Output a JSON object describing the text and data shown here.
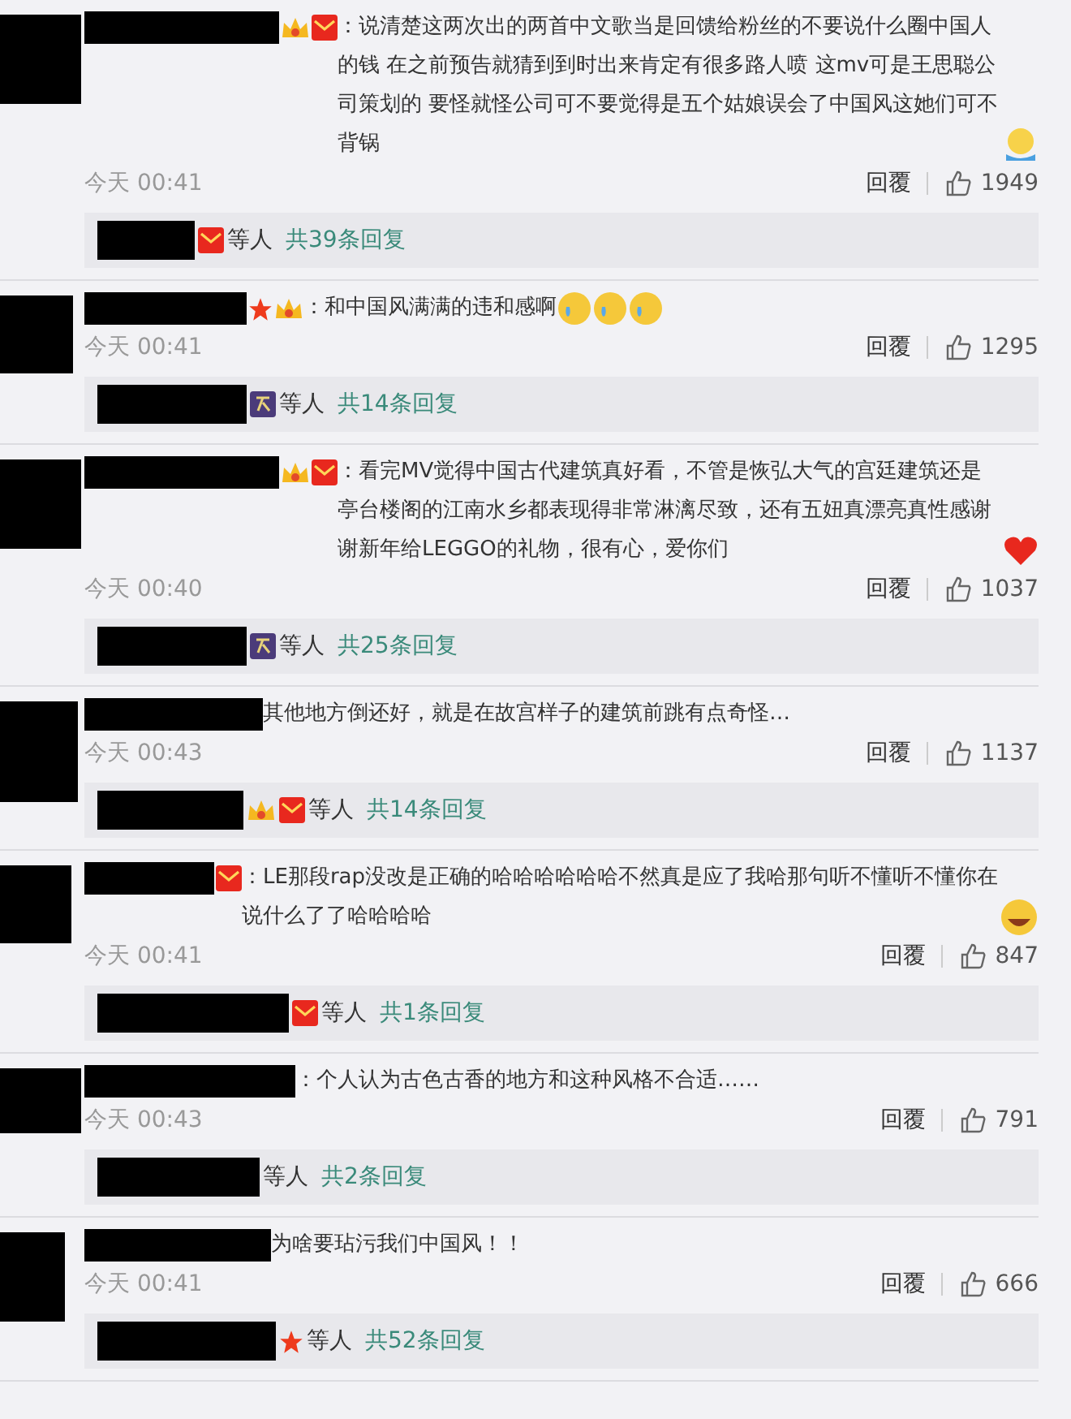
{
  "comments": [
    {
      "badges": [
        {
          "kind": "crown"
        },
        {
          "kind": "envelope"
        }
      ],
      "text": "：说清楚这两次出的两首中文歌当是回馈给粉丝的不要说什么圈中国人的钱 在之前预告就猜到到时出来肯定有很多路人喷 这mv可是王思聪公司策划的 要怪就怪公司可不要觉得是五个姑娘误会了中国风这她们可不背锅",
      "emoji": [
        {
          "kind": "shrug"
        }
      ],
      "time": "今天 00:41",
      "reply_label": "回覆",
      "likes": "1949",
      "replies": {
        "badges": [
          {
            "kind": "envelope"
          }
        ],
        "suffix": "等人",
        "link": "共39条回复"
      }
    },
    {
      "badges": [
        {
          "kind": "star"
        },
        {
          "kind": "crown"
        }
      ],
      "text": "：和中国风满满的违和感啊",
      "emoji": [
        {
          "kind": "cry"
        },
        {
          "kind": "cry"
        },
        {
          "kind": "cry"
        }
      ],
      "time": "今天 00:41",
      "reply_label": "回覆",
      "likes": "1295",
      "replies": {
        "badges": [
          {
            "kind": "night"
          }
        ],
        "suffix": "等人",
        "link": "共14条回复"
      }
    },
    {
      "badges": [
        {
          "kind": "crown"
        },
        {
          "kind": "envelope"
        }
      ],
      "text": "：看完MV觉得中国古代建筑真好看，不管是恢弘大气的宫廷建筑还是亭台楼阁的江南水乡都表现得非常淋漓尽致，还有五妞真漂亮真性感谢谢新年给LEGGO的礼物，很有心，爱你们",
      "emoji": [
        {
          "kind": "heart"
        }
      ],
      "time": "今天 00:40",
      "reply_label": "回覆",
      "likes": "1037",
      "replies": {
        "badges": [
          {
            "kind": "night"
          }
        ],
        "suffix": "等人",
        "link": "共25条回复"
      }
    },
    {
      "text": "其他地方倒还好，就是在故宫样子的建筑前跳有点奇怪…",
      "time": "今天 00:43",
      "reply_label": "回覆",
      "likes": "1137",
      "replies": {
        "badges": [
          {
            "kind": "crown"
          },
          {
            "kind": "envelope"
          }
        ],
        "suffix": "等人",
        "link": "共14条回复"
      }
    },
    {
      "badges": [
        {
          "kind": "envelope"
        }
      ],
      "text": "：LE那段rap没改是正确的哈哈哈哈哈哈不然真是应了我哈那句听不懂听不懂你在说什么了了哈哈哈哈",
      "emoji": [
        {
          "kind": "laugh"
        }
      ],
      "time": "今天 00:41",
      "reply_label": "回覆",
      "likes": "847",
      "replies": {
        "badges": [
          {
            "kind": "envelope"
          }
        ],
        "suffix": "等人",
        "link": "共1条回复"
      }
    },
    {
      "text": "：个人认为古色古香的地方和这种风格不合适……",
      "time": "今天 00:43",
      "reply_label": "回覆",
      "likes": "791",
      "replies": {
        "suffix": "等人",
        "link": "共2条回复"
      }
    },
    {
      "text": "为啥要玷污我们中国风！！",
      "time": "今天 00:41",
      "reply_label": "回覆",
      "likes": "666",
      "replies": {
        "badges": [
          {
            "kind": "star"
          }
        ],
        "suffix": "等人",
        "link": "共52条回复"
      }
    }
  ]
}
